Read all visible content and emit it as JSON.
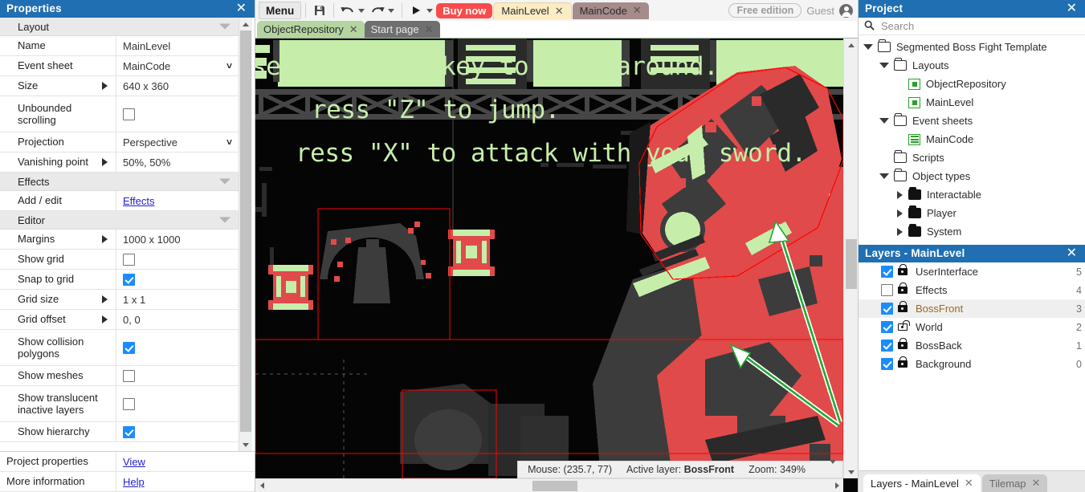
{
  "properties_panel": {
    "title": "Properties",
    "close_icon": "close-icon",
    "groups": [
      {
        "name": "Layout",
        "rows": [
          {
            "label": "Name",
            "value": "MainLevel",
            "kind": "text"
          },
          {
            "label": "Event sheet",
            "value": "MainCode",
            "kind": "dropdown"
          },
          {
            "label": "Size",
            "value": "640 x 360",
            "kind": "expandable"
          },
          {
            "label": "Unbounded scrolling",
            "value": "",
            "kind": "checkbox",
            "checked": false
          },
          {
            "label": "Projection",
            "value": "Perspective",
            "kind": "dropdown"
          },
          {
            "label": "Vanishing point",
            "value": "50%, 50%",
            "kind": "expandable"
          }
        ]
      },
      {
        "name": "Effects",
        "rows": [
          {
            "label": "Add / edit",
            "value": "Effects",
            "kind": "link"
          }
        ]
      },
      {
        "name": "Editor",
        "rows": [
          {
            "label": "Margins",
            "value": "1000 x 1000",
            "kind": "expandable"
          },
          {
            "label": "Show grid",
            "value": "",
            "kind": "checkbox",
            "checked": false
          },
          {
            "label": "Snap to grid",
            "value": "",
            "kind": "checkbox",
            "checked": true
          },
          {
            "label": "Grid size",
            "value": "1 x 1",
            "kind": "expandable"
          },
          {
            "label": "Grid offset",
            "value": "0, 0",
            "kind": "expandable"
          },
          {
            "label": "Show collision polygons",
            "value": "",
            "kind": "checkbox",
            "checked": true
          },
          {
            "label": "Show meshes",
            "value": "",
            "kind": "checkbox",
            "checked": false
          },
          {
            "label": "Show translucent inactive layers",
            "value": "",
            "kind": "checkbox",
            "checked": false
          },
          {
            "label": "Show hierarchy",
            "value": "",
            "kind": "checkbox",
            "checked": true
          }
        ]
      }
    ],
    "footer": [
      {
        "label": "Project properties",
        "value": "View",
        "kind": "link"
      },
      {
        "label": "More information",
        "value": "Help",
        "kind": "link"
      }
    ]
  },
  "toolbar": {
    "menu_label": "Menu",
    "save_icon": "save-icon",
    "undo_icon": "undo-icon",
    "redo_icon": "redo-icon",
    "run_icon": "play-icon",
    "buy_now_label": "Buy now",
    "open_tabs": [
      {
        "label": "MainLevel",
        "active": true
      },
      {
        "label": "MainCode",
        "active": false
      }
    ],
    "edition_label": "Free edition",
    "user_label": "Guest",
    "avatar_icon": "account-icon"
  },
  "document_tabs": [
    {
      "label": "ObjectRepository",
      "active": true
    },
    {
      "label": "Start page",
      "active": false
    }
  ],
  "canvas": {
    "overlay_text_lines": [
      "se the arrow key to move around.",
      "ress \"Z\" to jump.",
      "ress \"X\" to attack with your sword."
    ],
    "colors": {
      "background": "#050505",
      "screen_green": "#c6eeaa",
      "boss_red": "#e04a4a",
      "dark_gray": "#3c3c3c",
      "selection_red": "#ff0000",
      "arrow_green": "#22aa33"
    }
  },
  "status_bar": {
    "mouse_label": "Mouse:",
    "mouse_value": "(235.7, 77)",
    "active_layer_label": "Active layer:",
    "active_layer_value": "BossFront",
    "zoom_label": "Zoom:",
    "zoom_value": "349%",
    "caret_icon": "chevron-down-icon"
  },
  "project_panel": {
    "title": "Project",
    "close_icon": "close-icon",
    "search": {
      "placeholder": "Search",
      "value": "",
      "icon": "search-icon"
    },
    "tree": [
      {
        "label": "Segmented Boss Fight Template",
        "depth": 0,
        "caret": "down",
        "icon": "folder"
      },
      {
        "label": "Layouts",
        "depth": 1,
        "caret": "down",
        "icon": "folder"
      },
      {
        "label": "ObjectRepository",
        "depth": 2,
        "caret": "none",
        "icon": "layout"
      },
      {
        "label": "MainLevel",
        "depth": 2,
        "caret": "none",
        "icon": "layout"
      },
      {
        "label": "Event sheets",
        "depth": 1,
        "caret": "down",
        "icon": "folder"
      },
      {
        "label": "MainCode",
        "depth": 2,
        "caret": "none",
        "icon": "sheet"
      },
      {
        "label": "Scripts",
        "depth": 1,
        "caret": "none",
        "icon": "folder"
      },
      {
        "label": "Object types",
        "depth": 1,
        "caret": "down",
        "icon": "folder"
      },
      {
        "label": "Interactable",
        "depth": 2,
        "caret": "right",
        "icon": "folder-filled"
      },
      {
        "label": "Player",
        "depth": 2,
        "caret": "right",
        "icon": "folder-filled"
      },
      {
        "label": "System",
        "depth": 2,
        "caret": "right",
        "icon": "folder-filled"
      }
    ]
  },
  "layers_panel": {
    "title": "Layers - MainLevel",
    "close_icon": "close-icon",
    "layers": [
      {
        "name": "UserInterface",
        "visible": true,
        "locked": true,
        "index": "5",
        "selected": false
      },
      {
        "name": "Effects",
        "visible": false,
        "locked": true,
        "index": "4",
        "selected": false
      },
      {
        "name": "BossFront",
        "visible": true,
        "locked": true,
        "index": "3",
        "selected": true
      },
      {
        "name": "World",
        "visible": true,
        "locked": false,
        "index": "2",
        "selected": false
      },
      {
        "name": "BossBack",
        "visible": true,
        "locked": true,
        "index": "1",
        "selected": false
      },
      {
        "name": "Background",
        "visible": true,
        "locked": true,
        "index": "0",
        "selected": false
      }
    ]
  },
  "bottom_tabs": [
    {
      "label": "Layers - MainLevel",
      "active": true
    },
    {
      "label": "Tilemap",
      "active": false
    }
  ]
}
